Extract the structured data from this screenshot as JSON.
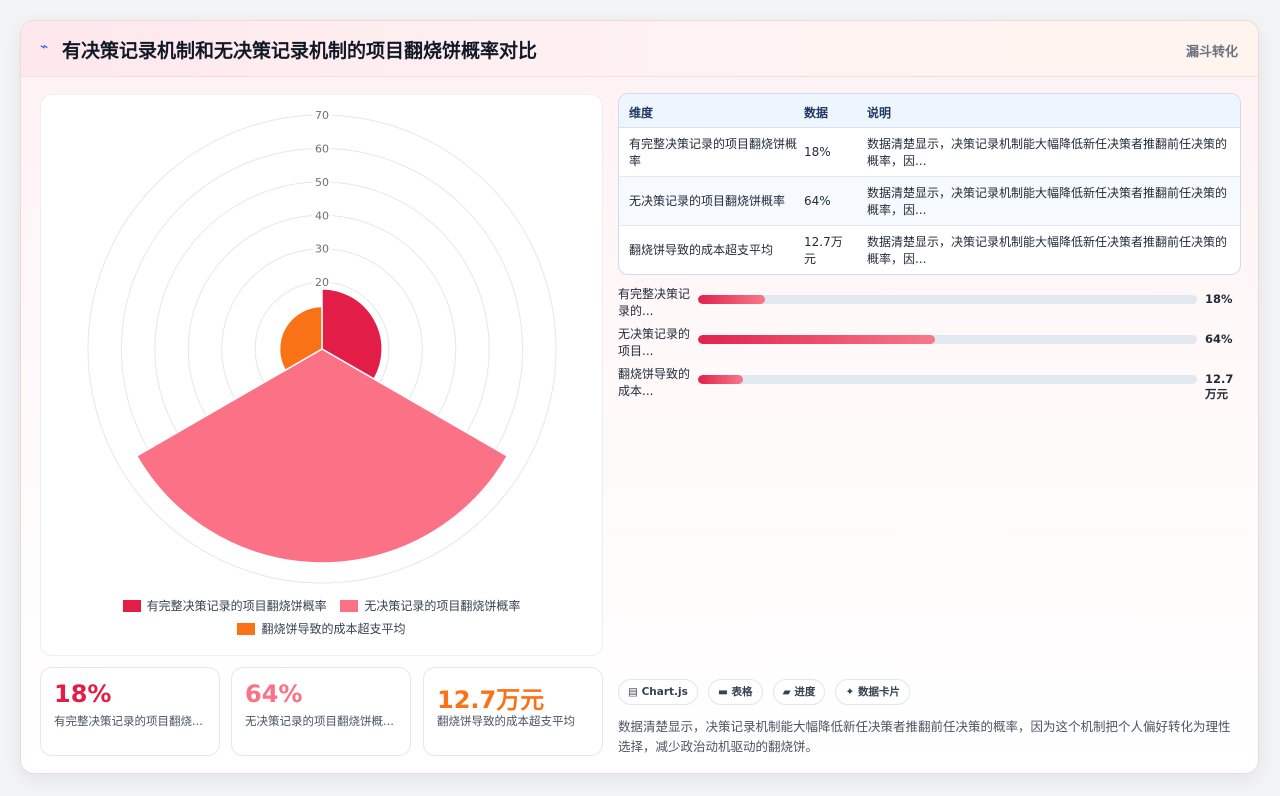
{
  "header": {
    "logo_icon": "spark-icon",
    "title": "有决策记录机制和无决策记录机制的项目翻烧饼概率对比",
    "tag": "漏斗转化"
  },
  "chart_data": {
    "type": "polarArea",
    "categories": [
      "有完整决策记录的项目翻烧饼概率",
      "无决策记录的项目翻烧饼概率",
      "翻烧饼导致的成本超支平均"
    ],
    "values": [
      18,
      64,
      12.7
    ],
    "colors": [
      "#e11d48",
      "#fb7185",
      "#f97316"
    ],
    "r_axis": {
      "min": 0,
      "max": 70,
      "ticks": [
        20,
        30,
        40,
        50,
        60,
        70
      ]
    },
    "legend": "bottom",
    "grid": true
  },
  "legend": [
    {
      "label": "有完整决策记录的项目翻烧饼概率",
      "color": "#e11d48"
    },
    {
      "label": "无决策记录的项目翻烧饼概率",
      "color": "#fb7185"
    },
    {
      "label": "翻烧饼导致的成本超支平均",
      "color": "#f97316"
    }
  ],
  "stats": [
    {
      "value": "18%",
      "label": "有完整决策记录的项目翻烧...",
      "color": "#e11d48"
    },
    {
      "value": "64%",
      "label": "无决策记录的项目翻烧饼概...",
      "color": "#fb7185"
    },
    {
      "value": "12.7万元",
      "label": "翻烧饼导致的成本超支平均",
      "color": "#f97316"
    }
  ],
  "table": {
    "headers": [
      "维度",
      "数据",
      "说明"
    ],
    "rows": [
      {
        "dim": "有完整决策记录的项目翻烧饼概率",
        "val": "18%",
        "desc": "数据清楚显示，决策记录机制能大幅降低新任决策者推翻前任决策的概率，因..."
      },
      {
        "dim": "无决策记录的项目翻烧饼概率",
        "val": "64%",
        "desc": "数据清楚显示，决策记录机制能大幅降低新任决策者推翻前任决策的概率，因..."
      },
      {
        "dim": "翻烧饼导致的成本超支平均",
        "val": "12.7万元",
        "desc": "数据清楚显示，决策记录机制能大幅降低新任决策者推翻前任决策的概率，因..."
      }
    ]
  },
  "progress": [
    {
      "label": "有完整决策记录的...",
      "value_text": "18%",
      "fraction": 0.135
    },
    {
      "label": "无决策记录的项目...",
      "value_text": "64%",
      "fraction": 0.475
    },
    {
      "label": "翻烧饼导致的成本...",
      "value_text": "12.7万元",
      "fraction": 0.09
    }
  ],
  "chips": [
    {
      "icon": "chart-icon",
      "label": "▤ Chart.js"
    },
    {
      "icon": "table-icon",
      "label": "▬ 表格"
    },
    {
      "icon": "progress-icon",
      "label": "▰ 进度"
    },
    {
      "icon": "sparkle-icon",
      "label": "✦ 数据卡片"
    }
  ],
  "summary": "数据清楚显示，决策记录机制能大幅降低新任决策者推翻前任决策的概率，因为这个机制把个人偏好转化为理性选择，减少政治动机驱动的翻烧饼。"
}
